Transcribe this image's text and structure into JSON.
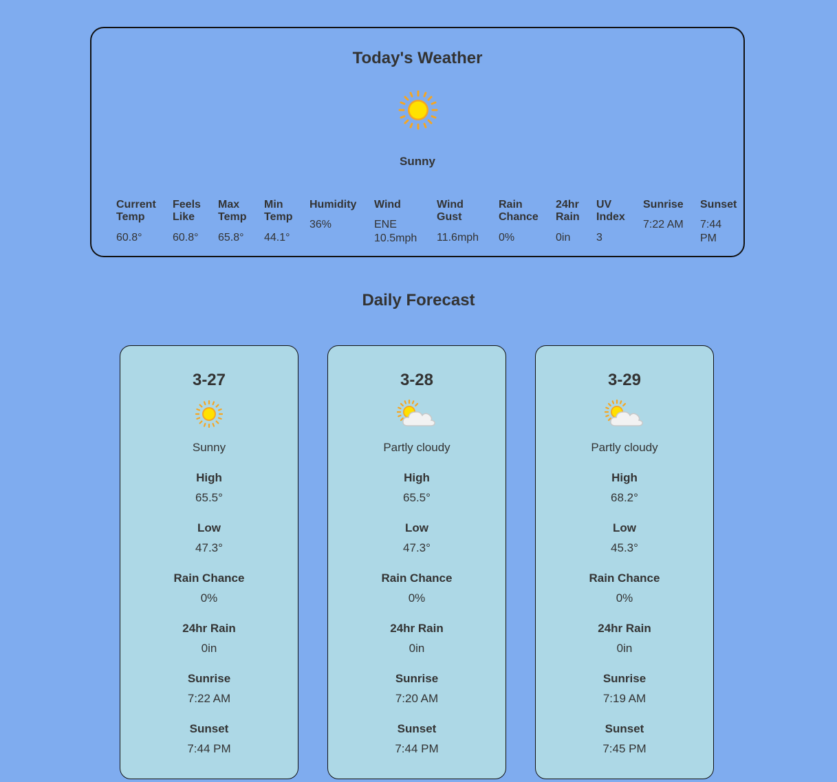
{
  "today": {
    "title": "Today's Weather",
    "condition": "Sunny",
    "icon": "sun-icon",
    "stats": [
      {
        "label": "Current Temp",
        "value": "60.8°"
      },
      {
        "label": "Feels Like",
        "value": "60.8°"
      },
      {
        "label": "Max Temp",
        "value": "65.8°"
      },
      {
        "label": "Min Temp",
        "value": "44.1°"
      },
      {
        "label": "Humidity",
        "value": "36%"
      },
      {
        "label": "Wind",
        "value": "ENE 10.5mph"
      },
      {
        "label": "Wind Gust",
        "value": "11.6mph"
      },
      {
        "label": "Rain Chance",
        "value": "0%"
      },
      {
        "label": "24hr Rain",
        "value": "0in"
      },
      {
        "label": "UV Index",
        "value": "3"
      },
      {
        "label": "Sunrise",
        "value": "7:22 AM"
      },
      {
        "label": "Sunset",
        "value": "7:44 PM"
      }
    ]
  },
  "forecast": {
    "title": "Daily Forecast",
    "days": [
      {
        "date": "3-27",
        "icon": "sun-icon",
        "condition": "Sunny",
        "stats": [
          {
            "label": "High",
            "value": "65.5°"
          },
          {
            "label": "Low",
            "value": "47.3°"
          },
          {
            "label": "Rain Chance",
            "value": "0%"
          },
          {
            "label": "24hr Rain",
            "value": "0in"
          },
          {
            "label": "Sunrise",
            "value": "7:22 AM"
          },
          {
            "label": "Sunset",
            "value": "7:44 PM"
          }
        ]
      },
      {
        "date": "3-28",
        "icon": "partly-cloudy-icon",
        "condition": "Partly cloudy",
        "stats": [
          {
            "label": "High",
            "value": "65.5°"
          },
          {
            "label": "Low",
            "value": "47.3°"
          },
          {
            "label": "Rain Chance",
            "value": "0%"
          },
          {
            "label": "24hr Rain",
            "value": "0in"
          },
          {
            "label": "Sunrise",
            "value": "7:20 AM"
          },
          {
            "label": "Sunset",
            "value": "7:44 PM"
          }
        ]
      },
      {
        "date": "3-29",
        "icon": "partly-cloudy-icon",
        "condition": "Partly cloudy",
        "stats": [
          {
            "label": "High",
            "value": "68.2°"
          },
          {
            "label": "Low",
            "value": "45.3°"
          },
          {
            "label": "Rain Chance",
            "value": "0%"
          },
          {
            "label": "24hr Rain",
            "value": "0in"
          },
          {
            "label": "Sunrise",
            "value": "7:19 AM"
          },
          {
            "label": "Sunset",
            "value": "7:45 PM"
          }
        ]
      }
    ]
  },
  "colors": {
    "background": "#7facef",
    "card": "#add8e6",
    "text": "#333333",
    "sun": "#ffd700",
    "sun_rays": "#f5a623"
  }
}
